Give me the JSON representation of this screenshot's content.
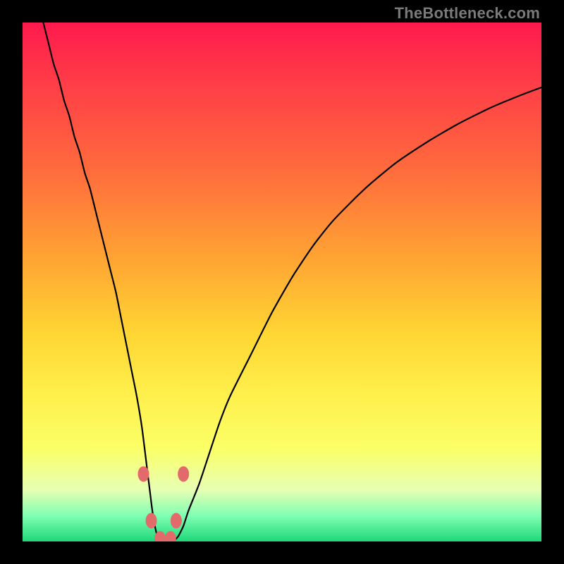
{
  "attribution": "TheBottleneck.com",
  "chart_data": {
    "type": "line",
    "title": "",
    "xlabel": "",
    "ylabel": "",
    "xlim": [
      0,
      100
    ],
    "ylim": [
      0,
      100
    ],
    "series": [
      {
        "name": "bottleneck-curve",
        "x": [
          4,
          5,
          6,
          7,
          8,
          9,
          10,
          11,
          12,
          13,
          14,
          15,
          16,
          17,
          18,
          19,
          20,
          21,
          22,
          23,
          24,
          24.5,
          25,
          25.5,
          26,
          27,
          28,
          29,
          30,
          31,
          32,
          34,
          36,
          38,
          40,
          44,
          48,
          52,
          56,
          60,
          66,
          72,
          78,
          84,
          90,
          96,
          100
        ],
        "values": [
          100,
          96,
          92,
          89,
          85,
          82,
          78,
          75,
          71,
          68,
          64,
          60,
          56,
          52,
          48,
          43,
          38,
          33,
          28,
          22,
          14,
          10,
          6,
          3,
          1,
          0,
          0,
          0,
          1,
          3,
          6,
          11,
          17,
          23,
          28,
          36,
          44,
          51,
          57,
          62,
          68,
          73,
          77,
          80.5,
          83.5,
          86,
          87.5
        ]
      }
    ],
    "markers": [
      {
        "x": 23.3,
        "y": 13
      },
      {
        "x": 31.0,
        "y": 13
      },
      {
        "x": 24.8,
        "y": 4
      },
      {
        "x": 29.6,
        "y": 4
      },
      {
        "x": 26.5,
        "y": 0.5
      },
      {
        "x": 28.5,
        "y": 0.5
      }
    ],
    "gradient_stops": [
      {
        "pos": 0,
        "color": "#ff1a4d"
      },
      {
        "pos": 60,
        "color": "#ffd633"
      },
      {
        "pos": 100,
        "color": "#1fd87a"
      }
    ]
  }
}
